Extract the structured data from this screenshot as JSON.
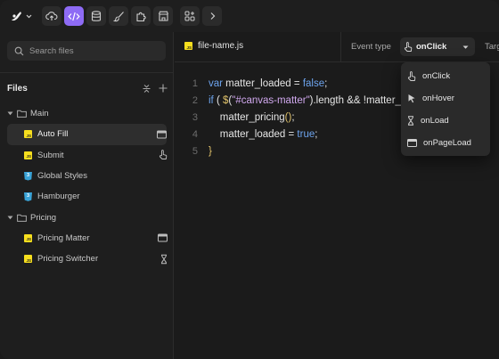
{
  "toolbar": {
    "brand_icon": "brand-logo-icon",
    "buttons": [
      {
        "name": "cloud-upload-icon"
      },
      {
        "name": "code-icon",
        "active": true
      },
      {
        "name": "database-icon"
      },
      {
        "name": "brush-icon"
      },
      {
        "name": "puzzle-icon"
      },
      {
        "name": "store-icon"
      }
    ],
    "extra_buttons": [
      {
        "name": "components-icon"
      },
      {
        "name": "chevron-right-icon"
      }
    ],
    "accent_color": "#8e6bf5"
  },
  "sidebar": {
    "search_placeholder": "Search files",
    "files_title": "Files",
    "tree": [
      {
        "type": "folder",
        "label": "Main"
      },
      {
        "type": "js",
        "label": "Auto Fill",
        "selected": true,
        "trail_icon": "page-load-icon"
      },
      {
        "type": "js",
        "label": "Submit",
        "trail_icon": "hand-pointer-icon"
      },
      {
        "type": "css",
        "label": "Global Styles"
      },
      {
        "type": "css",
        "label": "Hamburger"
      },
      {
        "type": "folder",
        "label": "Pricing"
      },
      {
        "type": "js",
        "label": "Pricing Matter",
        "trail_icon": "page-load-icon"
      },
      {
        "type": "js",
        "label": "Pricing Switcher",
        "trail_icon": "hourglass-icon"
      }
    ]
  },
  "editor": {
    "file_name": "file-name.js",
    "event_type_label": "Event type",
    "event_value": "onClick",
    "target_label": "Target",
    "line_numbers": [
      "1",
      "2",
      "3",
      "4",
      "5"
    ],
    "code": {
      "l1_kw": "var",
      "l1_name": " matter_loaded = ",
      "l1_val": "false",
      "l1_end": ";",
      "l2_kw": "if",
      "l2_a": " ( ",
      "l2_fn": "$",
      "l2_b": "(",
      "l2_str": "\"#canvas-matter\"",
      "l2_c": ").length && !matter_loaded) {",
      "l3": "    matter_pricing",
      "l3_p": "()",
      "l3_end": ";",
      "l4_a": "    matter_loaded = ",
      "l4_val": "true",
      "l4_end": ";",
      "l5": "}"
    }
  },
  "dropdown": {
    "options": [
      {
        "label": "onClick",
        "icon": "hand-pointer-icon"
      },
      {
        "label": "onHover",
        "icon": "cursor-arrow-icon"
      },
      {
        "label": "onLoad",
        "icon": "hourglass-icon"
      },
      {
        "label": "onPageLoad",
        "icon": "page-load-icon"
      }
    ]
  }
}
